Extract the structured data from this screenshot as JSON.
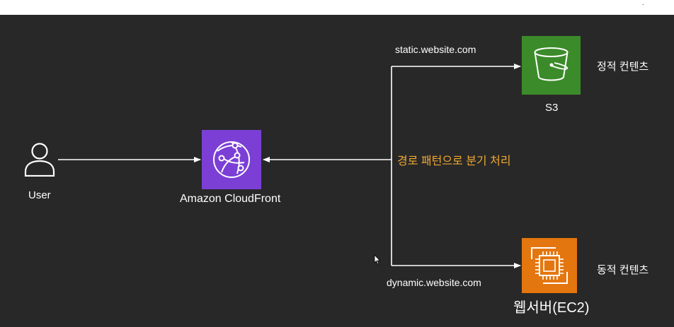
{
  "nodes": {
    "user": {
      "label": "User",
      "icon": "user-icon"
    },
    "cloudfront": {
      "label": "Amazon CloudFront",
      "icon": "cloudfront-icon"
    },
    "s3": {
      "label": "S3",
      "icon": "s3-bucket-icon",
      "description": "정적 컨텐츠"
    },
    "ec2": {
      "label": "웹서버(EC2)",
      "icon": "ec2-chip-icon",
      "description": "동적 컨텐츠"
    }
  },
  "edges": {
    "static_domain": "static.website.com",
    "dynamic_domain": "dynamic.website.com",
    "routing_label": "경로 패턴으로 분기 처리"
  },
  "colors": {
    "background": "#282828",
    "cloudfront": "#7b3fd6",
    "s3": "#3c8b2a",
    "ec2": "#e4760f",
    "routing_text": "#f0a830"
  }
}
